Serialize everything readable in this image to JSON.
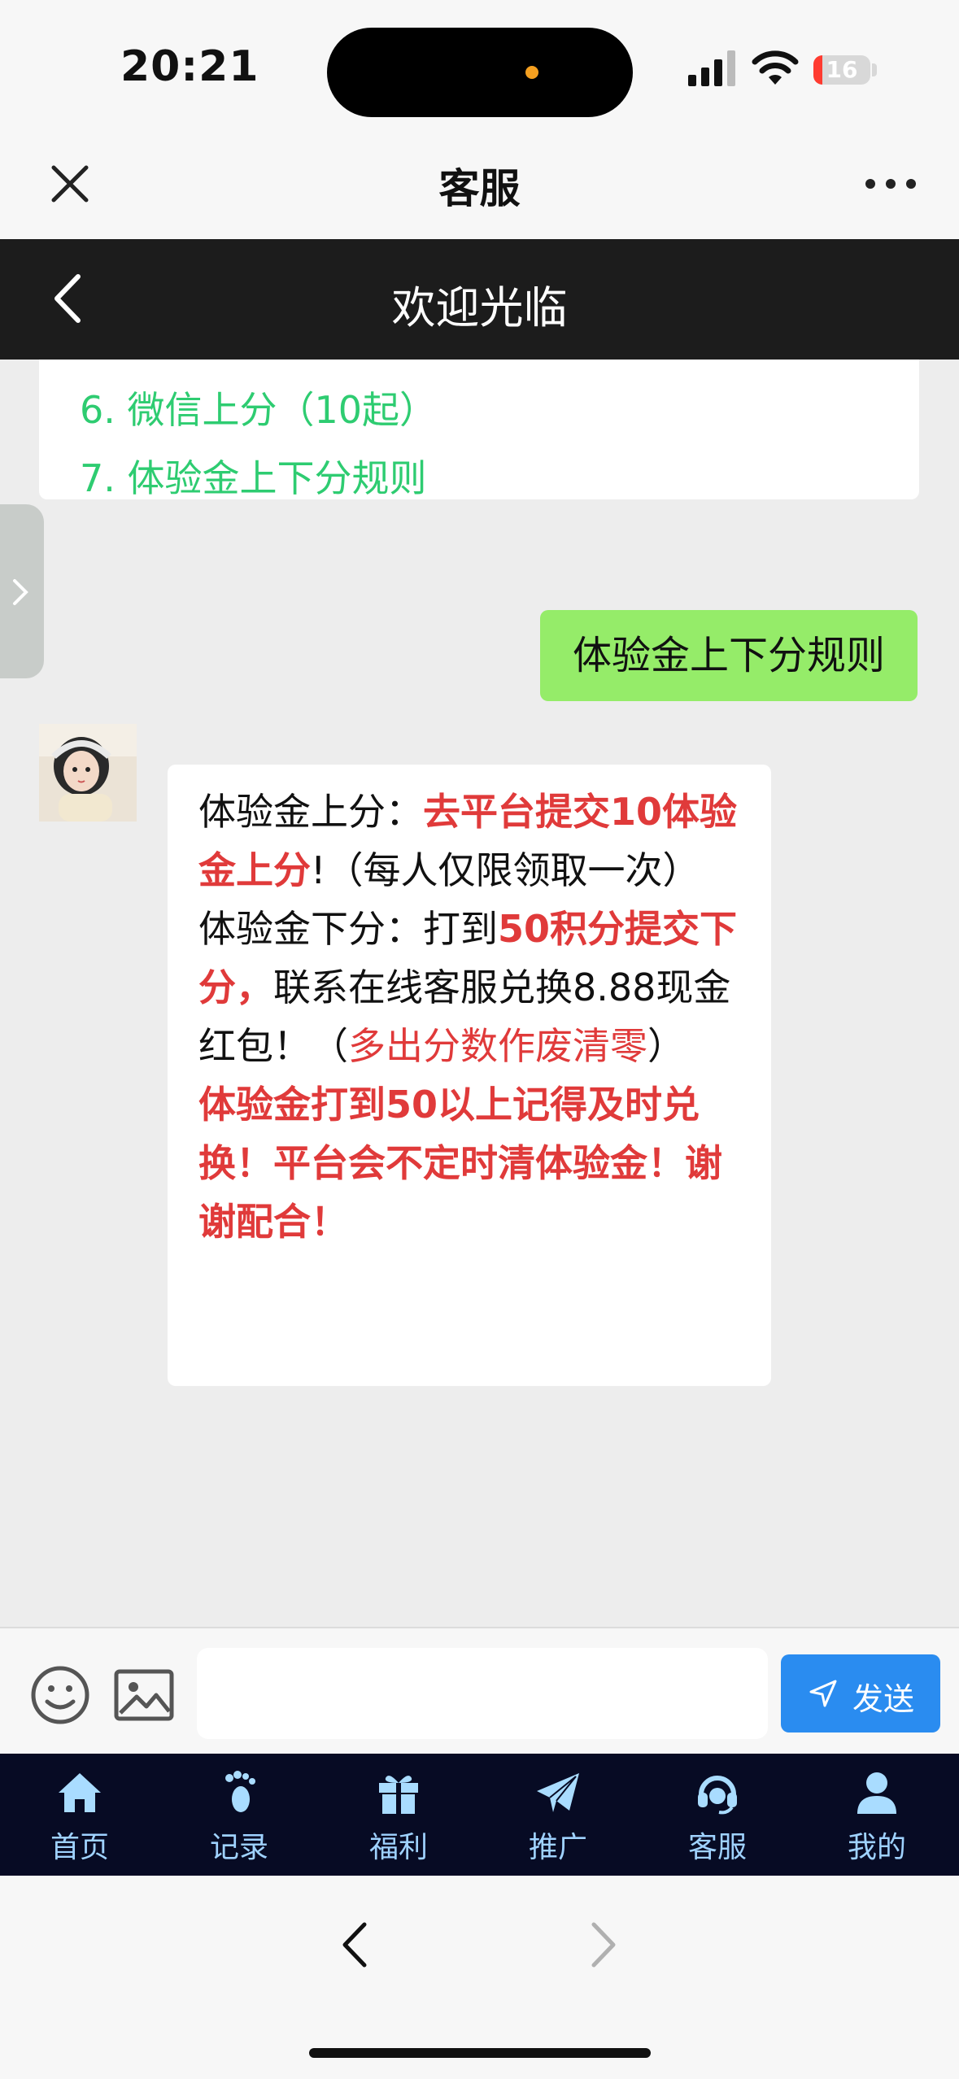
{
  "status_bar": {
    "time": "20:21",
    "battery": "16",
    "battery_level": 0.16
  },
  "navbar": {
    "title": "客服",
    "close_icon": "close-icon",
    "more_icon": "more-icon"
  },
  "page_header": {
    "title": "欢迎光临"
  },
  "chat": {
    "menu_items": [
      "6. 微信上分（10起）",
      "7. 体验金上下分规则"
    ],
    "user_message": "体验金上下分规则",
    "bot_message": {
      "line1_label": "体验金上分：",
      "line1_red": "去平台提交10体验金上分",
      "line1_rest": "!（每人仅限领取一次）",
      "line2_label": "体验金下分：打到",
      "line2_red": "50积分提交下分，",
      "line2_rest": "联系在线客服兑换8.88现金红包！（",
      "line2_red2": "多出分数作废清零",
      "line2_close": "）",
      "warning": "体验金打到50以上记得及时兑换！平台会不定时清体验金！谢谢配合！"
    }
  },
  "input_bar": {
    "placeholder": "",
    "send_label": "发送"
  },
  "tabbar": {
    "items": [
      {
        "label": "首页",
        "icon": "home-icon"
      },
      {
        "label": "记录",
        "icon": "footprint-icon"
      },
      {
        "label": "福利",
        "icon": "gift-icon"
      },
      {
        "label": "推广",
        "icon": "paper-plane-icon"
      },
      {
        "label": "客服",
        "icon": "headset-icon"
      },
      {
        "label": "我的",
        "icon": "user-icon"
      }
    ]
  },
  "colors": {
    "accent_blue": "#2a8cf0",
    "menu_green": "#2ecc71",
    "user_bubble": "#95ec69",
    "alert_red": "#e03a3a",
    "tabbar_bg": "#070b24"
  }
}
